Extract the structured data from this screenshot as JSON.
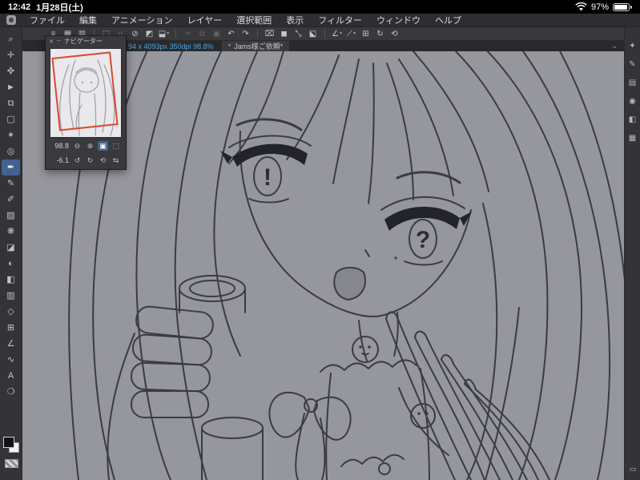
{
  "status_bar": {
    "time": "12:42",
    "date": "1月28日(土)",
    "battery_percent": "97%"
  },
  "menu_bar": {
    "items": [
      {
        "name": "menu-file",
        "label": "ファイル"
      },
      {
        "name": "menu-edit",
        "label": "編集"
      },
      {
        "name": "menu-animation",
        "label": "アニメーション"
      },
      {
        "name": "menu-layer",
        "label": "レイヤー"
      },
      {
        "name": "menu-selection",
        "label": "選択範囲"
      },
      {
        "name": "menu-view",
        "label": "表示"
      },
      {
        "name": "menu-filter",
        "label": "フィルター"
      },
      {
        "name": "menu-window",
        "label": "ウィンドウ"
      },
      {
        "name": "menu-help",
        "label": "ヘルプ"
      }
    ]
  },
  "command_bar": {
    "icons": [
      {
        "name": "hamburger-menu-icon",
        "glyph": "≡"
      },
      {
        "name": "workspace-icon",
        "glyph": "▦"
      },
      {
        "name": "gesture-settings-icon",
        "glyph": "▥"
      },
      {
        "name": "separator",
        "type": "separator",
        "interactable": false
      },
      {
        "name": "selection-rect-icon",
        "glyph": "⬚"
      },
      {
        "name": "selection-lasso-icon",
        "glyph": "◌"
      },
      {
        "name": "deselect-icon",
        "glyph": "⊘"
      },
      {
        "name": "invert-selection-icon",
        "glyph": "◩"
      },
      {
        "name": "selection-launcher-icon",
        "glyph": "⬓",
        "caret": true
      },
      {
        "name": "separator",
        "type": "separator",
        "interactable": false
      },
      {
        "name": "cut-icon",
        "glyph": "✂",
        "disabled": true
      },
      {
        "name": "copy-icon",
        "glyph": "⧉",
        "disabled": true
      },
      {
        "name": "paste-icon",
        "glyph": "▣",
        "disabled": true
      },
      {
        "name": "undo-icon",
        "glyph": "↶"
      },
      {
        "name": "redo-icon",
        "glyph": "↷"
      },
      {
        "name": "separator",
        "type": "separator",
        "interactable": false
      },
      {
        "name": "clear-icon",
        "glyph": "⌧"
      },
      {
        "name": "fill-color-icon",
        "glyph": "◼"
      },
      {
        "name": "scale-rotate-icon",
        "glyph": "⤡"
      },
      {
        "name": "free-transform-icon",
        "glyph": "⬕"
      },
      {
        "name": "separator",
        "type": "separator",
        "interactable": false
      },
      {
        "name": "snap-ruler-icon",
        "glyph": "∠",
        "caret": true
      },
      {
        "name": "snap-special-ruler-icon",
        "glyph": "⟋",
        "caret": true
      },
      {
        "name": "snap-grid-icon",
        "glyph": "⊞"
      },
      {
        "name": "view-rotate-icon",
        "glyph": "↻"
      },
      {
        "name": "reset-view-icon",
        "glyph": "⟲"
      }
    ]
  },
  "tab_bar": {
    "canvas_info": "94 x 4093px 350dpi 98.8%",
    "modified_dot": "●",
    "document_tab": "Jams様ご依頼*",
    "collapse_icon": "⌄"
  },
  "tool_bar": {
    "tools": [
      {
        "name": "zoom-tool",
        "glyph": "⌕"
      },
      {
        "name": "move-tool",
        "glyph": "✛"
      },
      {
        "name": "hand-tool",
        "glyph": "✜"
      },
      {
        "name": "object-tool",
        "glyph": "►"
      },
      {
        "name": "layer-move-tool",
        "glyph": "⧉"
      },
      {
        "name": "selection-tool",
        "glyph": "▢"
      },
      {
        "name": "auto-select-tool",
        "glyph": "✶"
      },
      {
        "name": "eyedropper-tool",
        "glyph": "◎"
      },
      {
        "name": "pen-tool",
        "glyph": "✒",
        "selected": true
      },
      {
        "name": "pencil-tool",
        "glyph": "✎"
      },
      {
        "name": "brush-tool",
        "glyph": "✐"
      },
      {
        "name": "airbrush-tool",
        "glyph": "▨"
      },
      {
        "name": "decoration-tool",
        "glyph": "❋"
      },
      {
        "name": "eraser-tool",
        "glyph": "◪"
      },
      {
        "name": "blend-tool",
        "glyph": "◐"
      },
      {
        "name": "fill-tool",
        "glyph": "◧"
      },
      {
        "name": "gradient-tool",
        "glyph": "▥"
      },
      {
        "name": "figure-tool",
        "glyph": "◇"
      },
      {
        "name": "frame-border-tool",
        "glyph": "⊞"
      },
      {
        "name": "ruler-tool",
        "glyph": "∠"
      },
      {
        "name": "correct-line-tool",
        "glyph": "∿"
      },
      {
        "name": "text-tool",
        "glyph": "A"
      },
      {
        "name": "balloon-tool",
        "glyph": "❍"
      }
    ]
  },
  "right_bar": {
    "icons": [
      {
        "name": "quick-access-panel-icon",
        "glyph": "✦"
      },
      {
        "name": "sub-tool-panel-icon",
        "glyph": "✎"
      },
      {
        "name": "tool-property-panel-icon",
        "glyph": "▤"
      },
      {
        "name": "brush-size-panel-icon",
        "glyph": "◉"
      },
      {
        "name": "color-panel-icon",
        "glyph": "◧"
      },
      {
        "name": "layer-panel-icon",
        "glyph": "▦"
      }
    ],
    "bottom_icon": "▭"
  },
  "navigator": {
    "title": "ナビゲーター",
    "close_icon": "✕",
    "minimize_icon": "─",
    "zoom_value": "98.8",
    "rotation_value": "-6.1",
    "zoom_controls": [
      {
        "name": "zoom-out-icon",
        "glyph": "⊖"
      },
      {
        "name": "zoom-in-icon",
        "glyph": "⊕"
      },
      {
        "name": "fit-to-screen-button",
        "glyph": "▣",
        "active": true
      },
      {
        "name": "actual-size-button",
        "glyph": "⬚"
      }
    ],
    "rotation_controls": [
      {
        "name": "rotate-left-icon",
        "glyph": "↺"
      },
      {
        "name": "rotate-right-icon",
        "glyph": "↻"
      },
      {
        "name": "reset-rotation-icon",
        "glyph": "⟲"
      },
      {
        "name": "flip-horizontal-icon",
        "glyph": "⇆"
      }
    ]
  },
  "artwork": {
    "left_eye_symbol": "!",
    "right_eye_symbol": "?"
  },
  "colors": {
    "accent_blue": "#44618f",
    "info_text_blue": "#4da3e0",
    "canvas_gray": "#96969d",
    "view_rect_red": "#d84a33"
  }
}
